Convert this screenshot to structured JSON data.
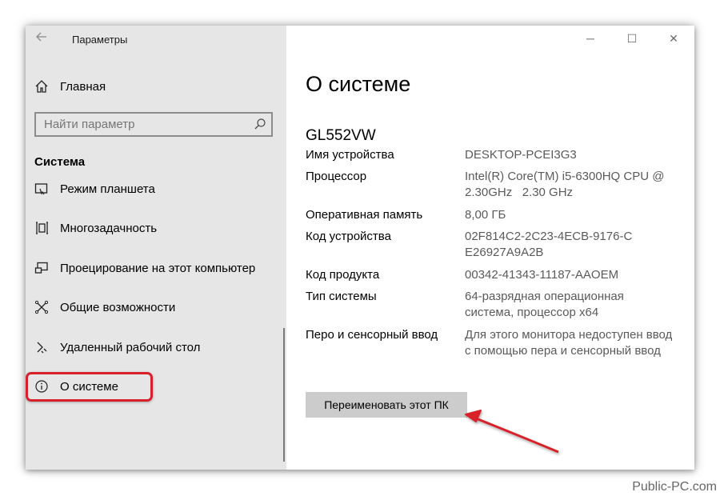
{
  "window": {
    "app_title": "Параметры",
    "controls": {
      "minimize": "─",
      "maximize": "☐",
      "close": "✕"
    }
  },
  "sidebar": {
    "home_label": "Главная",
    "search_placeholder": "Найти параметр",
    "section_title": "Система",
    "items": [
      {
        "label": "Режим планшета",
        "icon": "tablet-mode-icon"
      },
      {
        "label": "Многозадачность",
        "icon": "multitasking-icon"
      },
      {
        "label": "Проецирование на этот компьютер",
        "icon": "projecting-icon"
      },
      {
        "label": "Общие возможности",
        "icon": "shared-experiences-icon"
      },
      {
        "label": "Удаленный рабочий стол",
        "icon": "remote-desktop-icon"
      },
      {
        "label": "О системе",
        "icon": "info-icon",
        "selected": true
      }
    ]
  },
  "main": {
    "page_title": "О системе",
    "device_name": "GL552VW",
    "specs": [
      {
        "key": "Имя устройства",
        "value": "DESKTOP-PCEI3G3"
      },
      {
        "key": "Процессор",
        "value": "Intel(R) Core(TM) i5-6300HQ CPU @ 2.30GHz   2.30 GHz"
      },
      {
        "key": "Оперативная память",
        "value": "8,00 ГБ"
      },
      {
        "key": "Код устройства",
        "value": "02F814C2-2C23-4ECB-9176-CE26927A9A2B"
      },
      {
        "key": "Код продукта",
        "value": "00342-41343-11187-AAOEM"
      },
      {
        "key": "Тип системы",
        "value": "64-разрядная операционная система, процессор x64"
      },
      {
        "key": "Перо и сенсорный ввод",
        "value": "Для этого монитора недоступен ввод с помощью пера и сенсорный ввод"
      }
    ],
    "rename_button": "Переименовать этот ПК"
  },
  "annotation_color": "#d8202c",
  "watermark": "Public-PC.com"
}
